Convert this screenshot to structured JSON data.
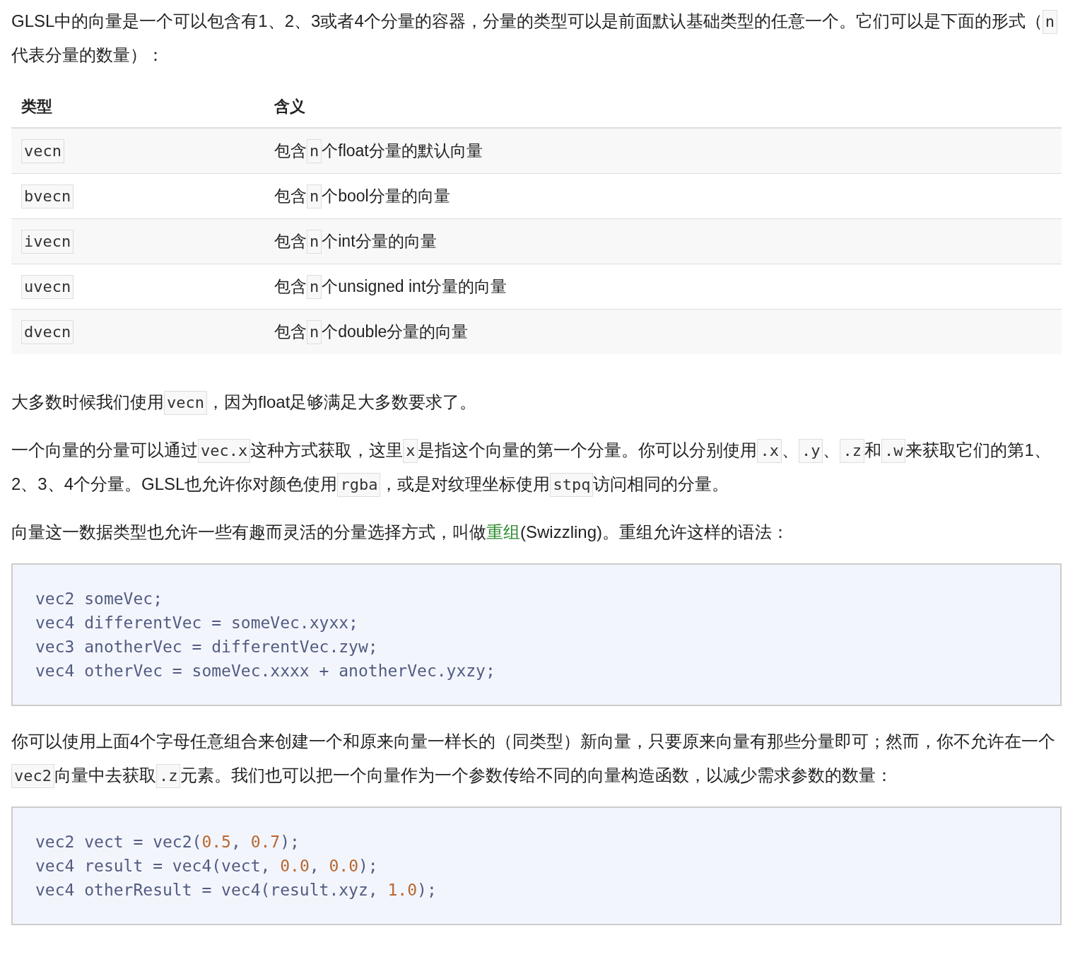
{
  "intro": [
    {
      "kind": "text",
      "text": "GLSL中的向量是一个可以包含有1、2、3或者4个分量的容器，分量的类型可以是前面默认基础类型的任意一个。它们可以是下面的形式（"
    },
    {
      "kind": "code",
      "text": "n"
    },
    {
      "kind": "text",
      "text": "代表分量的数量）："
    }
  ],
  "table": {
    "columns": [
      "类型",
      "含义"
    ],
    "rows": [
      {
        "type": "vecn",
        "meaning": [
          {
            "kind": "text",
            "text": "包含"
          },
          {
            "kind": "code",
            "text": "n"
          },
          {
            "kind": "text",
            "text": "个float分量的默认向量"
          }
        ]
      },
      {
        "type": "bvecn",
        "meaning": [
          {
            "kind": "text",
            "text": "包含"
          },
          {
            "kind": "code",
            "text": "n"
          },
          {
            "kind": "text",
            "text": "个bool分量的向量"
          }
        ]
      },
      {
        "type": "ivecn",
        "meaning": [
          {
            "kind": "text",
            "text": "包含"
          },
          {
            "kind": "code",
            "text": "n"
          },
          {
            "kind": "text",
            "text": "个int分量的向量"
          }
        ]
      },
      {
        "type": "uvecn",
        "meaning": [
          {
            "kind": "text",
            "text": "包含"
          },
          {
            "kind": "code",
            "text": "n"
          },
          {
            "kind": "text",
            "text": "个unsigned int分量的向量"
          }
        ]
      },
      {
        "type": "dvecn",
        "meaning": [
          {
            "kind": "text",
            "text": "包含"
          },
          {
            "kind": "code",
            "text": "n"
          },
          {
            "kind": "text",
            "text": "个double分量的向量"
          }
        ]
      }
    ]
  },
  "blocks": [
    {
      "kind": "paragraph",
      "segments": [
        {
          "kind": "text",
          "text": "大多数时候我们使用"
        },
        {
          "kind": "code",
          "text": "vecn"
        },
        {
          "kind": "text",
          "text": "，因为float足够满足大多数要求了。"
        }
      ]
    },
    {
      "kind": "paragraph",
      "segments": [
        {
          "kind": "text",
          "text": "一个向量的分量可以通过"
        },
        {
          "kind": "code",
          "text": "vec.x"
        },
        {
          "kind": "text",
          "text": "这种方式获取，这里"
        },
        {
          "kind": "code",
          "text": "x"
        },
        {
          "kind": "text",
          "text": "是指这个向量的第一个分量。你可以分别使用"
        },
        {
          "kind": "code",
          "text": ".x"
        },
        {
          "kind": "text",
          "text": "、"
        },
        {
          "kind": "code",
          "text": ".y"
        },
        {
          "kind": "text",
          "text": "、"
        },
        {
          "kind": "code",
          "text": ".z"
        },
        {
          "kind": "text",
          "text": "和"
        },
        {
          "kind": "code",
          "text": ".w"
        },
        {
          "kind": "text",
          "text": "来获取它们的第1、2、3、4个分量。GLSL也允许你对颜色使用"
        },
        {
          "kind": "code",
          "text": "rgba"
        },
        {
          "kind": "text",
          "text": "，或是对纹理坐标使用"
        },
        {
          "kind": "code",
          "text": "stpq"
        },
        {
          "kind": "text",
          "text": "访问相同的分量。"
        }
      ]
    },
    {
      "kind": "paragraph",
      "segments": [
        {
          "kind": "text",
          "text": "向量这一数据类型也允许一些有趣而灵活的分量选择方式，叫做"
        },
        {
          "kind": "link",
          "text": "重组"
        },
        {
          "kind": "text",
          "text": "(Swizzling)。重组允许这样的语法："
        }
      ]
    },
    {
      "kind": "code",
      "lines": [
        [
          {
            "kind": "plain",
            "text": "vec2 someVec;"
          }
        ],
        [
          {
            "kind": "plain",
            "text": "vec4 differentVec = someVec.xyxx;"
          }
        ],
        [
          {
            "kind": "plain",
            "text": "vec3 anotherVec = differentVec.zyw;"
          }
        ],
        [
          {
            "kind": "plain",
            "text": "vec4 otherVec = someVec.xxxx + anotherVec.yxzy;"
          }
        ]
      ]
    },
    {
      "kind": "paragraph",
      "segments": [
        {
          "kind": "text",
          "text": "你可以使用上面4个字母任意组合来创建一个和原来向量一样长的（同类型）新向量，只要原来向量有那些分量即可；然而，你不允许在一个"
        },
        {
          "kind": "code",
          "text": "vec2"
        },
        {
          "kind": "text",
          "text": "向量中去获取"
        },
        {
          "kind": "code",
          "text": ".z"
        },
        {
          "kind": "text",
          "text": "元素。我们也可以把一个向量作为一个参数传给不同的向量构造函数，以减少需求参数的数量："
        }
      ]
    },
    {
      "kind": "code",
      "lines": [
        [
          {
            "kind": "plain",
            "text": "vec2 vect = vec2("
          },
          {
            "kind": "number",
            "text": "0.5"
          },
          {
            "kind": "plain",
            "text": ", "
          },
          {
            "kind": "number",
            "text": "0.7"
          },
          {
            "kind": "plain",
            "text": ");"
          }
        ],
        [
          {
            "kind": "plain",
            "text": "vec4 result = vec4(vect, "
          },
          {
            "kind": "number",
            "text": "0.0"
          },
          {
            "kind": "plain",
            "text": ", "
          },
          {
            "kind": "number",
            "text": "0.0"
          },
          {
            "kind": "plain",
            "text": ");"
          }
        ],
        [
          {
            "kind": "plain",
            "text": "vec4 otherResult = vec4(result.xyz, "
          },
          {
            "kind": "number",
            "text": "1.0"
          },
          {
            "kind": "plain",
            "text": ");"
          }
        ]
      ]
    }
  ]
}
